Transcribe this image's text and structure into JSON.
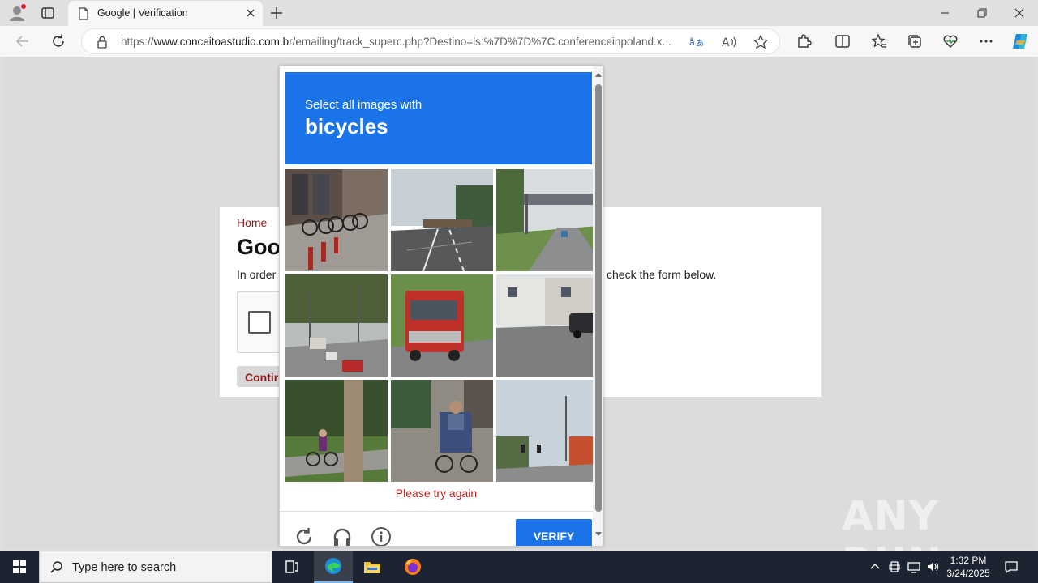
{
  "browser": {
    "tab_title": "Google | Verification",
    "url_prefix": "https://",
    "url_domain": "www.conceitoastudio.com.br",
    "url_rest": "/emailing/track_superc.php?Destino=ls:%7D%7D%7C.conferenceinpoland.x..."
  },
  "page": {
    "breadcrumb": "Home",
    "heading": "Goo",
    "intro_left": "In order",
    "intro_right": "check the form below.",
    "continue_label": "Contir"
  },
  "captcha": {
    "instruction": "Select all images with",
    "object": "bicycles",
    "tiles": [
      "bike-rack-street",
      "highway-overpass",
      "road-with-sign-gantry",
      "town-street-traffic",
      "red-truck",
      "houses-parked-car",
      "person-cycling-park",
      "tricycle-street",
      "street-traffic-lights"
    ],
    "error_message": "Please try again",
    "verify_label": "VERIFY",
    "header_color": "#1a73e8"
  },
  "watermark": "ANY RUN",
  "taskbar": {
    "search_placeholder": "Type here to search",
    "time": "1:32 PM",
    "date": "3/24/2025"
  }
}
